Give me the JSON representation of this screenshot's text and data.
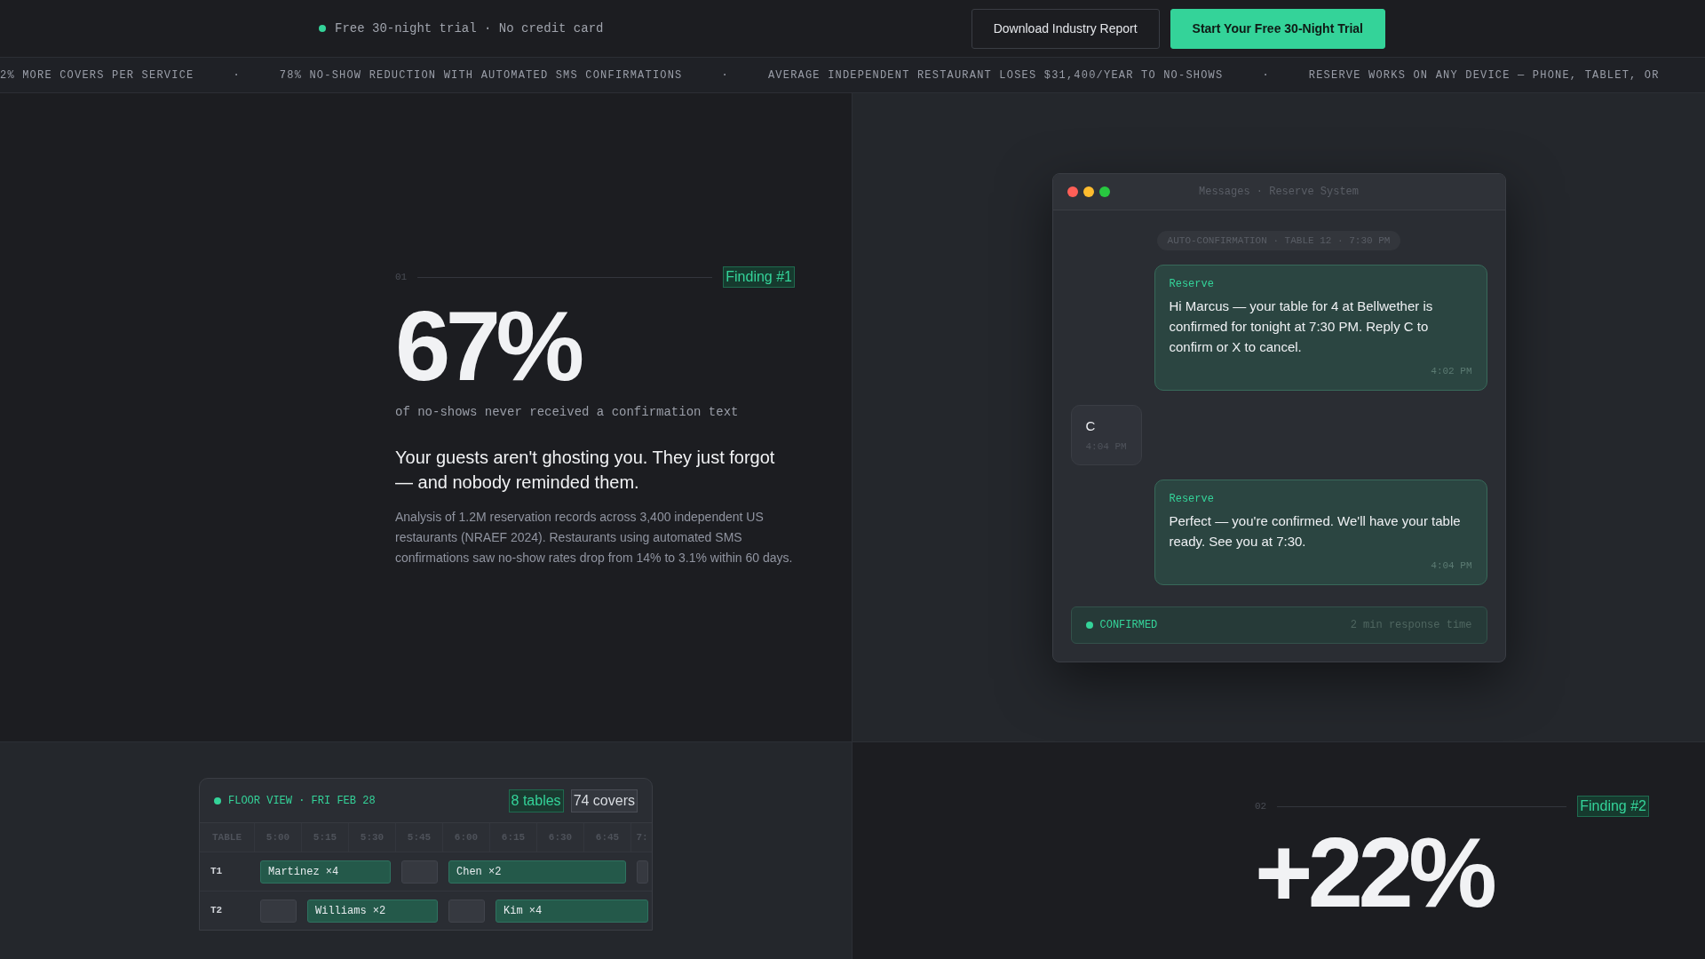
{
  "top_bar": {
    "trial_note": "Free 30-night trial · No credit card",
    "buttons": [
      {
        "label": "Download Industry Report",
        "kind": "secondary"
      },
      {
        "label": "Start Your Free 30-Night Trial",
        "kind": "primary"
      }
    ]
  },
  "ticker": {
    "items": [
      "2% MORE COVERS PER SERVICE",
      "78% NO-SHOW REDUCTION WITH AUTOMATED SMS CONFIRMATIONS",
      "AVERAGE INDEPENDENT RESTAURANT LOSES $31,400/YEAR TO NO-SHOWS",
      "RESERVE WORKS ON ANY DEVICE — PHONE, TABLET, OR"
    ],
    "separator": "·"
  },
  "finding_1": {
    "number": "01",
    "tag": "Finding #1",
    "stat": "67%",
    "stat_caption": "of no-shows never received a confirmation text",
    "headline": "Your guests aren't ghosting you. They just forgot — and nobody reminded them.",
    "body": "Analysis of 1.2M reservation records across 3,400 independent US restaurants (NRAEF 2024). Restaurants using automated SMS confirmations saw no-show rates drop from 14% to 3.1% within 60 days."
  },
  "messages_window": {
    "title": "Messages · Reserve System",
    "context_pill": "AUTO-CONFIRMATION · TABLE 12 · 7:30 PM",
    "messages": [
      {
        "kind": "outgoing",
        "sender": "Reserve",
        "text": "Hi Marcus — your table for 4 at Bellwether is confirmed for tonight at 7:30 PM. Reply C to confirm or X to cancel.",
        "time": "4:02 PM"
      },
      {
        "kind": "incoming",
        "text": "C",
        "time": "4:04 PM"
      },
      {
        "kind": "outgoing",
        "sender": "Reserve",
        "text": "Perfect — you're confirmed. We'll have your table ready. See you at 7:30.",
        "time": "4:04 PM"
      }
    ],
    "status": {
      "label": "CONFIRMED",
      "note": "2 min response time"
    }
  },
  "floor_view": {
    "title": "FLOOR VIEW · FRI FEB 28",
    "badges": [
      {
        "label": "8 tables",
        "kind": "accent"
      },
      {
        "label": "74 covers",
        "kind": "plain"
      }
    ],
    "columns": [
      "TABLE",
      "5:00",
      "5:15",
      "5:30",
      "5:45",
      "6:00",
      "6:15",
      "6:30",
      "6:45",
      "7:"
    ],
    "rows": [
      {
        "table": "T1",
        "slots": [
          {
            "kind": "booking",
            "label": "Martinez ×4"
          },
          {
            "kind": "continued"
          },
          {
            "kind": "continued"
          },
          {
            "kind": "free"
          },
          {
            "kind": "booking",
            "label": "Chen ×2"
          },
          {
            "kind": "continued"
          },
          {
            "kind": "continued"
          },
          {
            "kind": "continued"
          },
          {
            "kind": "free"
          }
        ]
      },
      {
        "table": "T2",
        "slots": [
          {
            "kind": "free"
          },
          {
            "kind": "booking",
            "label": "Williams ×2"
          },
          {
            "kind": "continued"
          },
          {
            "kind": "continued"
          },
          {
            "kind": "free"
          },
          {
            "kind": "booking",
            "label": "Kim ×4"
          },
          {
            "kind": "continued"
          },
          {
            "kind": "continued"
          },
          {
            "kind": "continued"
          }
        ]
      }
    ]
  },
  "finding_2": {
    "number": "02",
    "tag": "Finding #2",
    "stat": "+22%"
  }
}
